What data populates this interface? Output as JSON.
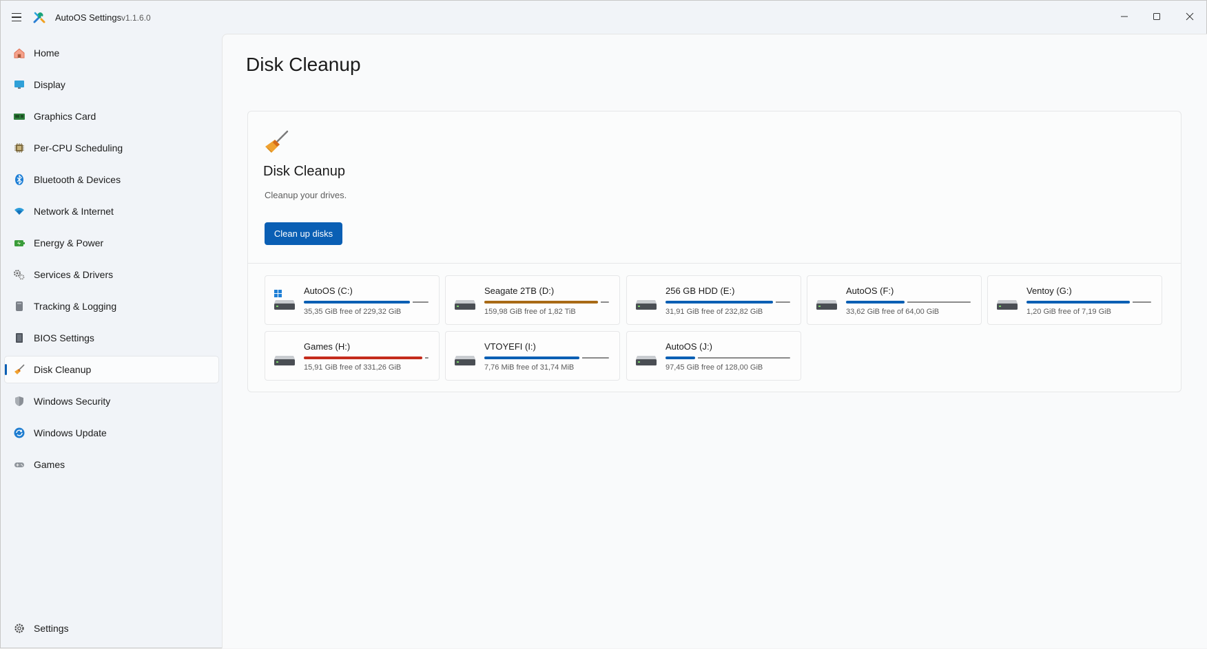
{
  "app": {
    "title": "AutoOS Settings",
    "version": "v1.1.6.0"
  },
  "sidebar": {
    "items": [
      {
        "label": "Home",
        "icon": "home-icon"
      },
      {
        "label": "Display",
        "icon": "display-icon"
      },
      {
        "label": "Graphics Card",
        "icon": "graphics-card-icon"
      },
      {
        "label": "Per-CPU Scheduling",
        "icon": "cpu-icon"
      },
      {
        "label": "Bluetooth & Devices",
        "icon": "bluetooth-icon"
      },
      {
        "label": "Network & Internet",
        "icon": "wifi-icon"
      },
      {
        "label": "Energy & Power",
        "icon": "battery-icon"
      },
      {
        "label": "Services & Drivers",
        "icon": "gears-icon"
      },
      {
        "label": "Tracking & Logging",
        "icon": "tracking-icon"
      },
      {
        "label": "BIOS Settings",
        "icon": "bios-icon"
      },
      {
        "label": "Disk Cleanup",
        "icon": "broom-icon",
        "active": true
      },
      {
        "label": "Windows Security",
        "icon": "shield-icon"
      },
      {
        "label": "Windows Update",
        "icon": "update-icon"
      },
      {
        "label": "Games",
        "icon": "gamepad-icon"
      }
    ],
    "footer": {
      "label": "Settings",
      "icon": "gear-icon"
    }
  },
  "page": {
    "title": "Disk Cleanup",
    "card": {
      "title": "Disk Cleanup",
      "description": "Cleanup your drives.",
      "button_label": "Clean up disks"
    }
  },
  "drives": [
    {
      "name": "AutoOS (C:)",
      "free_text": "35,35 GiB free of 229,32 GiB",
      "used_fraction": 0.85,
      "color": "#0a5fb4",
      "system": true
    },
    {
      "name": "Seagate 2TB (D:)",
      "free_text": "159,98 GiB free of 1,82 TiB",
      "used_fraction": 0.91,
      "color": "#a86a16",
      "system": false
    },
    {
      "name": "256 GB HDD (E:)",
      "free_text": "31,91 GiB free of 232,82 GiB",
      "used_fraction": 0.86,
      "color": "#0a5fb4",
      "system": false
    },
    {
      "name": "AutoOS (F:)",
      "free_text": "33,62 GiB free of 64,00 GiB",
      "used_fraction": 0.47,
      "color": "#0a5fb4",
      "system": false
    },
    {
      "name": "Ventoy (G:)",
      "free_text": "1,20 GiB free of 7,19 GiB",
      "used_fraction": 0.83,
      "color": "#0a5fb4",
      "system": false
    },
    {
      "name": "Games (H:)",
      "free_text": "15,91 GiB free of 331,26 GiB",
      "used_fraction": 0.95,
      "color": "#c42b1c",
      "system": false
    },
    {
      "name": "VTOYEFI (I:)",
      "free_text": "7,76 MiB free of 31,74 MiB",
      "used_fraction": 0.76,
      "color": "#0a5fb4",
      "system": false
    },
    {
      "name": "AutoOS (J:)",
      "free_text": "97,45 GiB free of 128,00 GiB",
      "used_fraction": 0.24,
      "color": "#0a5fb4",
      "system": false
    }
  ]
}
